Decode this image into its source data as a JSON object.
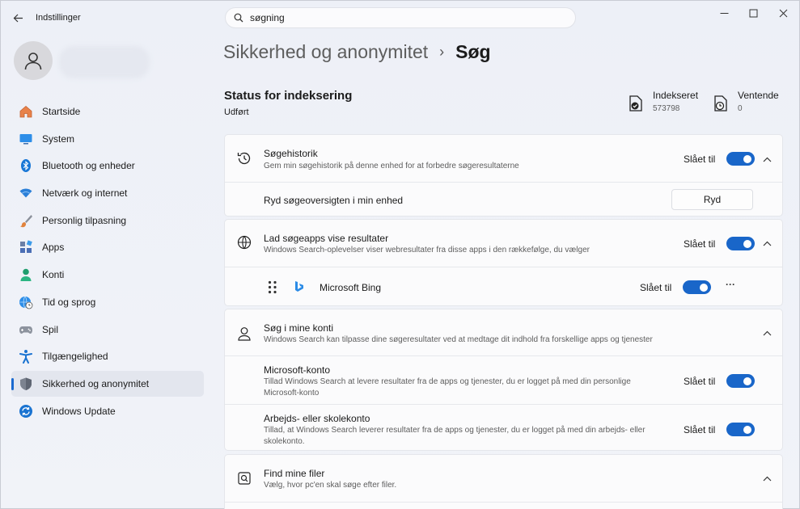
{
  "window": {
    "app_title": "Indstillinger",
    "search_value": "søgning"
  },
  "sidebar": {
    "items": [
      {
        "label": "Startside",
        "icon": "home-icon"
      },
      {
        "label": "System",
        "icon": "monitor-icon"
      },
      {
        "label": "Bluetooth og enheder",
        "icon": "bluetooth-icon"
      },
      {
        "label": "Netværk og internet",
        "icon": "wifi-icon"
      },
      {
        "label": "Personlig tilpasning",
        "icon": "brush-icon"
      },
      {
        "label": "Apps",
        "icon": "apps-icon"
      },
      {
        "label": "Konti",
        "icon": "person-icon"
      },
      {
        "label": "Tid og sprog",
        "icon": "globe-clock-icon"
      },
      {
        "label": "Spil",
        "icon": "gamepad-icon"
      },
      {
        "label": "Tilgængelighed",
        "icon": "accessibility-icon"
      },
      {
        "label": "Sikkerhed og anonymitet",
        "icon": "shield-icon",
        "active": true
      },
      {
        "label": "Windows Update",
        "icon": "update-icon"
      }
    ]
  },
  "header": {
    "parent": "Sikkerhed og anonymitet",
    "separator": "›",
    "current": "Søg"
  },
  "indexing": {
    "title": "Status for indeksering",
    "status": "Udført",
    "indexed_label": "Indekseret",
    "indexed_value": "573798",
    "pending_label": "Ventende",
    "pending_value": "0"
  },
  "search_history": {
    "title": "Søgehistorik",
    "desc": "Gem min søgehistorik på denne enhed for at forbedre søgeresultaterne",
    "toggle_label": "Slået til",
    "clear_title": "Ryd søgeoversigten i min enhed",
    "clear_button": "Ryd"
  },
  "search_apps": {
    "title": "Lad søgeapps vise resultater",
    "desc": "Windows Search-oplevelser viser webresultater fra disse apps i den rækkefølge, du vælger",
    "toggle_label": "Slået til",
    "bing_label": "Microsoft Bing",
    "bing_toggle_label": "Slået til",
    "more": "···"
  },
  "accounts": {
    "title": "Søg i mine konti",
    "desc": "Windows Search kan tilpasse dine søgeresultater ved at medtage dit indhold fra forskellige apps og tjenester",
    "ms_title": "Microsoft-konto",
    "ms_desc_1": "Tillad Windows Search at levere resultater fra de apps og tjenester, du er logget på med din personlige",
    "ms_desc_2": "Microsoft-konto",
    "ms_toggle_label": "Slået til",
    "work_title": "Arbejds- eller skolekonto",
    "work_desc_1": "Tillad, at Windows Search leverer resultater fra de apps og tjenester, du er logget på med din arbejds- eller",
    "work_desc_2": "skolekonto.",
    "work_toggle_label": "Slået til"
  },
  "find_files": {
    "title": "Find mine filer",
    "desc": "Vælg, hvor pc'en skal søge efter filer."
  },
  "colors": {
    "accent": "#1966c9",
    "background": "#eef0f6",
    "card": "#fbfbfc"
  }
}
